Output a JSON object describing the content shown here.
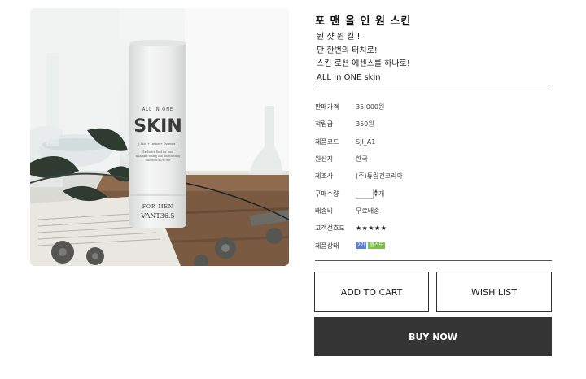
{
  "product": {
    "title": "포 맨 올 인 원 스킨",
    "description": [
      "원 샷 원 킬 !",
      "단 한번의 터치로!",
      "스킨 로션 에센스를 하나로!",
      "ALL In ONE skin"
    ],
    "image": {
      "bottle_text": {
        "line1": "ALL IN ONE",
        "brand": "SKIN",
        "sub": "[ Skin + Lotion + Essence ]",
        "fine": [
          "Exclusive fluid for men",
          "with skin-toning and moisturizing",
          "functions all in one"
        ],
        "for": "FOR MEN",
        "maker": "VANT36.5"
      }
    }
  },
  "specs": [
    {
      "label": "판매가격",
      "value": "35,000원"
    },
    {
      "label": "적립금",
      "value": "350원"
    },
    {
      "label": "제품코드",
      "value": "SJI_A1"
    },
    {
      "label": "원산지",
      "value": "한국"
    },
    {
      "label": "제조사",
      "value": "(주)튜링건코리아"
    },
    {
      "label": "구매수량",
      "value": "",
      "unit": "개"
    },
    {
      "label": "배송비",
      "value": "무료배송"
    },
    {
      "label": "고객선호도",
      "value": "★★★★★"
    },
    {
      "label": "제품상태",
      "badges": [
        "2기",
        "헬스도"
      ]
    }
  ],
  "buttons": {
    "add_to_cart": "ADD TO CART",
    "wish_list": "WISH LIST",
    "buy_now": "BUY NOW"
  },
  "colors": {
    "buy_bg": "#353535",
    "badge_blue": "#5a7fd6",
    "badge_green": "#7cc246"
  }
}
